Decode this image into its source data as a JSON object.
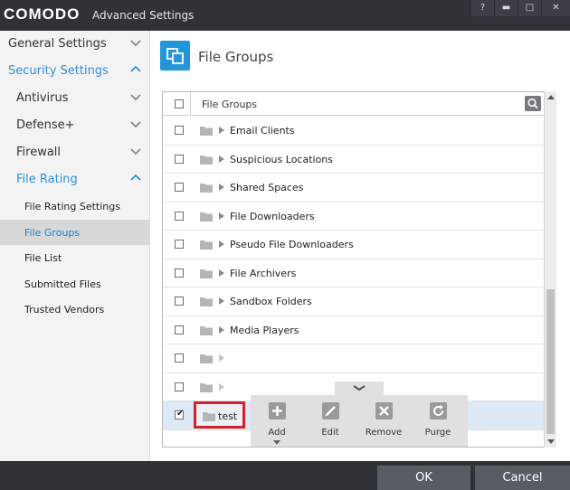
{
  "titlebar": {
    "logo": "COMODO",
    "title": "Advanced Settings",
    "help": "?",
    "minimize": "▬",
    "maximize": "□",
    "close": "✕"
  },
  "sidebar": {
    "general": "General Settings",
    "security": "Security Settings",
    "antivirus": "Antivirus",
    "defense": "Defense+",
    "firewall": "Firewall",
    "file_rating": "File Rating",
    "sub": [
      "File Rating Settings",
      "File Groups",
      "File List",
      "Submitted Files",
      "Trusted Vendors"
    ]
  },
  "main": {
    "title": "File Groups",
    "column": "File Groups",
    "rows": [
      "Email Clients",
      "Suspicious Locations",
      "Shared Spaces",
      "File Downloaders",
      "Pseudo File Downloaders",
      "File Archivers",
      "Sandbox Folders",
      "Media Players",
      "",
      "",
      "test"
    ]
  },
  "toolbar": {
    "add": "Add",
    "edit": "Edit",
    "remove": "Remove",
    "purge": "Purge"
  },
  "footer": {
    "ok": "OK",
    "cancel": "Cancel"
  },
  "colors": {
    "accent": "#2396d9",
    "titlebar": "#2f3338",
    "highlight": "#d3222c"
  }
}
